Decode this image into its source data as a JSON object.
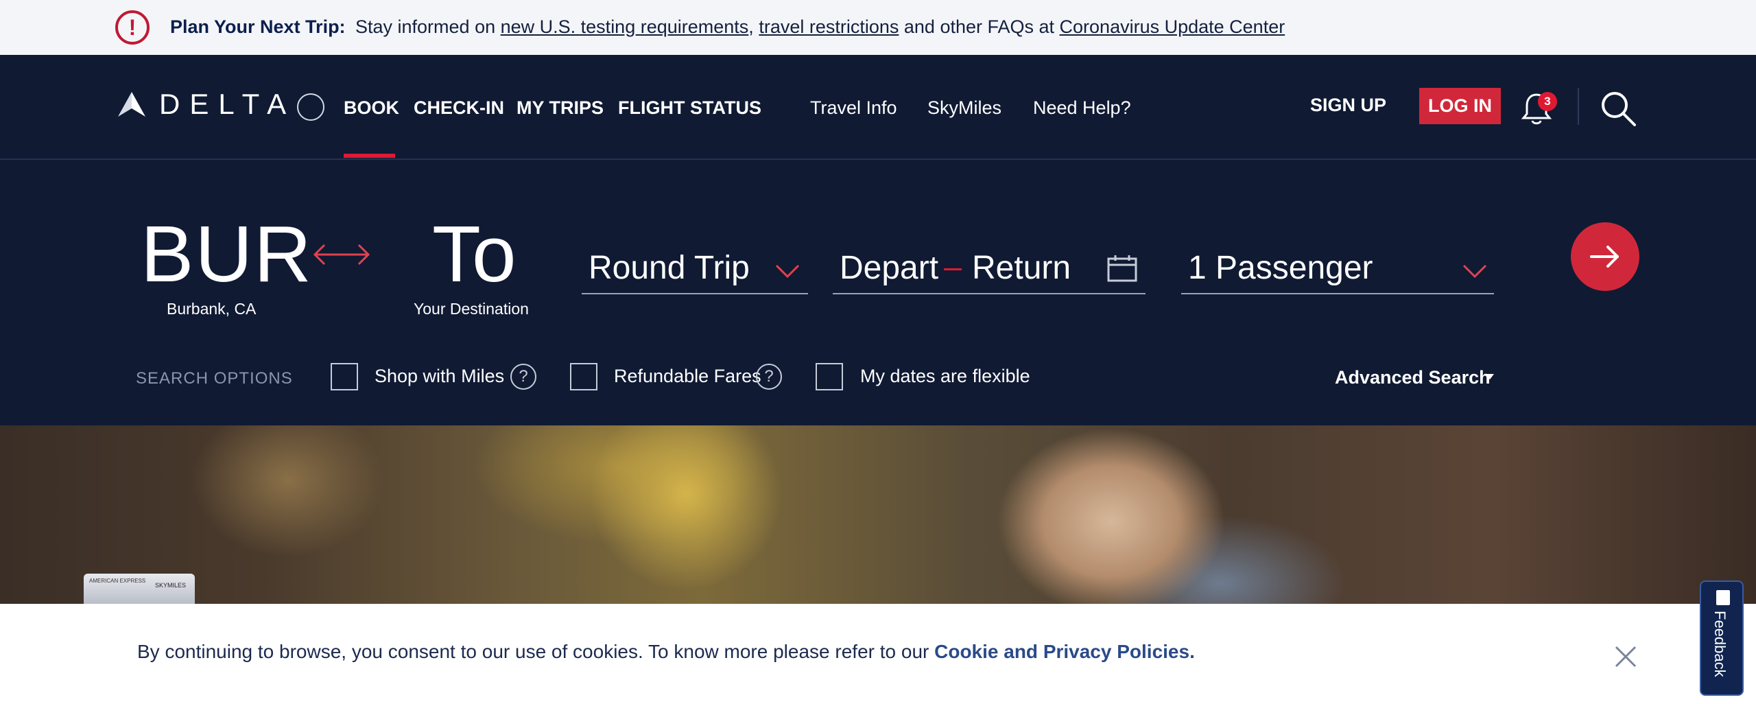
{
  "alert": {
    "title": "Plan Your Next Trip:",
    "text_start": "Stay informed on ",
    "link_testing": "new U.S. testing requirements",
    "comma": ",",
    "link_restrictions": "travel restrictions",
    "text_mid": " and other FAQs at ",
    "link_center": "Coronavirus Update Center",
    "icon": "exclamation-icon",
    "color": "#c01933"
  },
  "header": {
    "logo_text": "DELTA",
    "nav_primary": [
      "BOOK",
      "CHECK-IN",
      "MY TRIPS",
      "FLIGHT STATUS"
    ],
    "nav_secondary": [
      "Travel Info",
      "SkyMiles",
      "Need Help?"
    ],
    "sign_up": "SIGN UP",
    "log_in": "LOG IN",
    "notification_count": "3",
    "active_nav": "BOOK",
    "accent_color": "#e01933",
    "background": "#101a33"
  },
  "booking": {
    "from_code": "BUR",
    "from_city": "Burbank, CA",
    "to_code": "To",
    "to_city": "Your Destination",
    "trip_type": "Round Trip",
    "depart": "Depart",
    "return": "Return",
    "passengers": "1 Passenger",
    "search_options_label": "SEARCH OPTIONS",
    "options": [
      "Shop with Miles",
      "Refundable Fares",
      "My dates are flexible"
    ],
    "advanced_search": "Advanced Search"
  },
  "hero": {
    "card_issuer": "AMERICAN EXPRESS",
    "card_brand": "SKYMILES"
  },
  "cookie": {
    "text": "By continuing to browse, you consent to our use of cookies. To know more please refer to our ",
    "link": "Cookie and Privacy Policies."
  },
  "feedback": {
    "label": "Feedback"
  }
}
